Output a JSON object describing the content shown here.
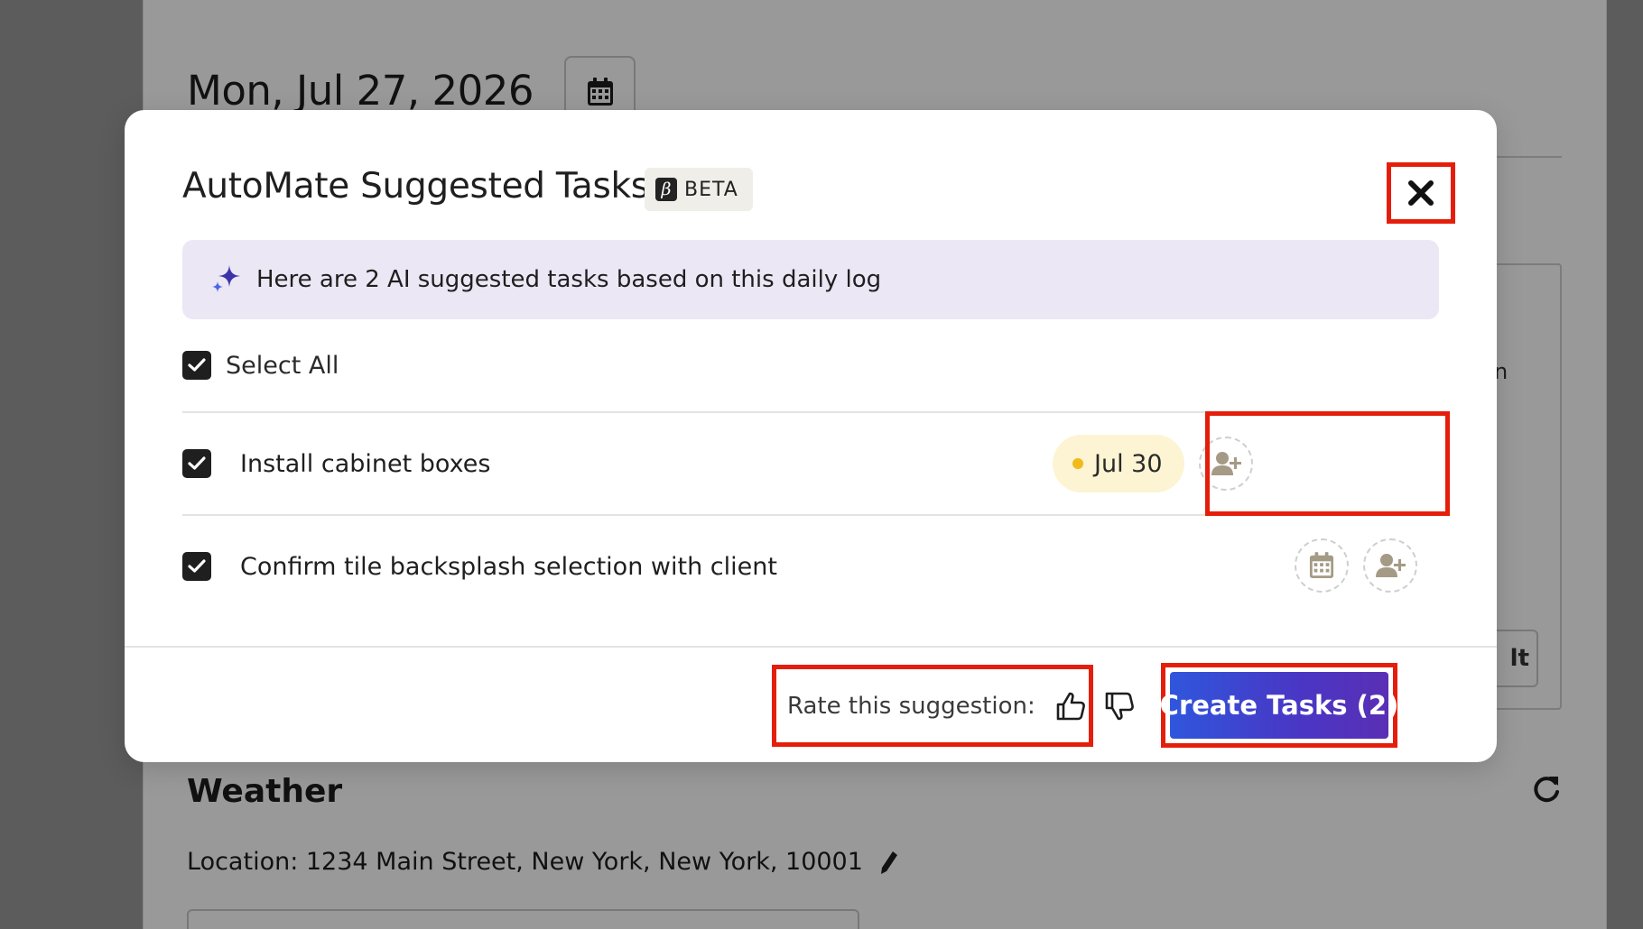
{
  "background": {
    "date": "Mon, Jul 27, 2026",
    "panel_text": "n",
    "panel_button": "lt",
    "weather_title": "Weather",
    "location": "Location: 1234 Main Street, New York, New York, 10001"
  },
  "modal": {
    "title": "AutoMate Suggested Tasks",
    "badge_icon": "β",
    "badge_label": "BETA",
    "banner_text": "Here are 2 AI suggested tasks based on this daily log",
    "select_all_label": "Select All",
    "tasks": [
      {
        "label": "Install cabinet boxes",
        "checked": true,
        "due": "Jul 30"
      },
      {
        "label": "Confirm tile backsplash selection with client",
        "checked": true,
        "due": ""
      }
    ],
    "rate_label": "Rate this suggestion:",
    "create_button": "Create Tasks (2)"
  },
  "colors": {
    "accent_gradient_start": "#2f56dc",
    "accent_gradient_end": "#5a2fb5",
    "highlight": "#e51e0c",
    "banner_bg": "#ebe7f5",
    "date_chip_bg": "#fcf4d2",
    "date_dot": "#f0bb1a"
  },
  "icons": {
    "calendar": "calendar-icon",
    "close": "close-icon",
    "sparkle": "sparkle-icon",
    "add_user": "add-user-icon",
    "thumbs_up": "thumbs-up-icon",
    "thumbs_down": "thumbs-down-icon",
    "refresh": "refresh-icon",
    "pencil": "pencil-icon"
  }
}
